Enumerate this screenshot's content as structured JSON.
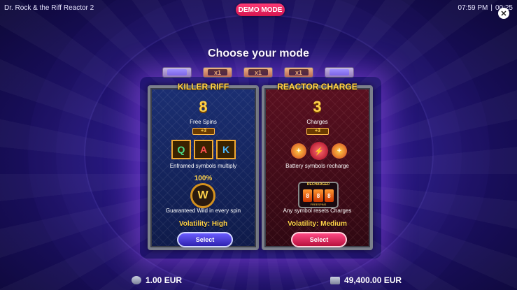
{
  "header": {
    "game_title": "Dr. Rock & the Riff Reactor 2",
    "demo_badge": "DEMO MODE",
    "time": "07:59 PM",
    "separator": "|",
    "session": "00:25"
  },
  "title": "Choose your mode",
  "batteries": [
    {
      "label": "",
      "charged": false
    },
    {
      "label": "x1",
      "charged": true
    },
    {
      "label": "x1",
      "charged": true
    },
    {
      "label": "x1",
      "charged": true
    },
    {
      "label": "",
      "charged": false
    }
  ],
  "modes": [
    {
      "title": "KILLER RIFF",
      "count": "8",
      "count_label": "Free Spins",
      "connector": "+3",
      "symbols": [
        "Q",
        "A",
        "K"
      ],
      "feature1": "Enframed symbols multiply",
      "wild_pct": "100%",
      "wild_letter": "W",
      "feature2": "Guaranteed Wild in every spin",
      "volatility": "Volatility: High",
      "button": "Select"
    },
    {
      "title": "REACTOR CHARGE",
      "count": "3",
      "count_label": "Charges",
      "connector": "+3",
      "feature1": "Battery symbols recharge",
      "recharge_label": "RECHARGED",
      "recharge_sub": "FREESPINS",
      "feature2": "Any symbol resets Charges",
      "volatility": "Volatility: Medium",
      "button": "Select"
    }
  ],
  "footer": {
    "bet": "1.00 EUR",
    "balance": "49,400.00 EUR"
  },
  "colors": {
    "accent_gold": "#ffd24a",
    "demo_pink": "#e0195a",
    "select_blue": "#4a3ee0",
    "select_red": "#e02a62"
  }
}
